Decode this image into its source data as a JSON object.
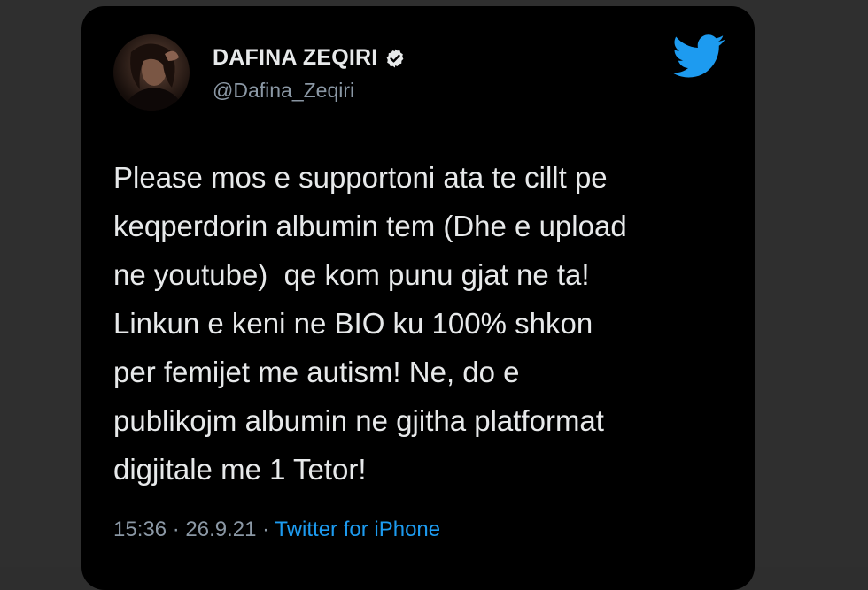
{
  "tweet": {
    "author": {
      "display_name": "DAFINA ZEQIRI",
      "handle": "@Dafina_Zeqiri",
      "verified": true,
      "avatar_icon": "profile-photo"
    },
    "brand_icon": "twitter-bird-icon",
    "brand_color": "#1d9bf0",
    "text_lines": [
      "Please mos e supportoni ata te cillt pe",
      "keqperdorin albumin tem (Dhe e upload",
      "ne youtube)  qe kom punu gjat ne ta!",
      "Linkun e keni ne BIO ku 100% shkon",
      "per femijet me autism! Ne, do e",
      "publikojm albumin ne gjitha platformat",
      "digjitale me 1 Tetor!"
    ],
    "meta": {
      "time": "15:36",
      "separator": " · ",
      "date": "26.9.21",
      "source": "Twitter for iPhone"
    }
  }
}
